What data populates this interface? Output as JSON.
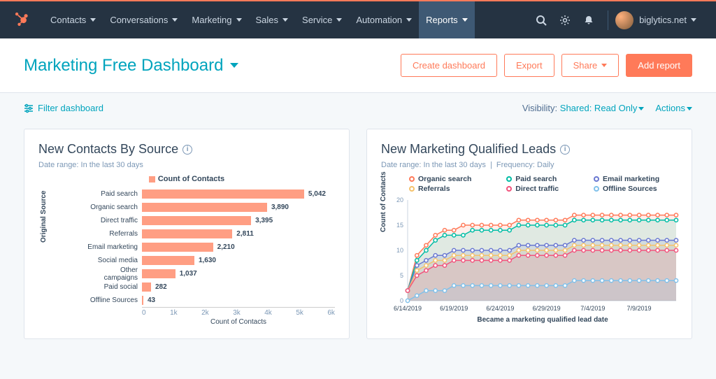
{
  "nav": {
    "items": [
      "Contacts",
      "Conversations",
      "Marketing",
      "Sales",
      "Service",
      "Automation",
      "Reports"
    ],
    "active_index": 6,
    "account": "biglytics.net"
  },
  "header": {
    "title": "Marketing Free Dashboard",
    "create": "Create dashboard",
    "export": "Export",
    "share": "Share",
    "add": "Add report"
  },
  "subheader": {
    "filter": "Filter dashboard",
    "vis_label": "Visibility:",
    "vis_value": "Shared: Read Only",
    "actions": "Actions"
  },
  "card1": {
    "title": "New Contacts By Source",
    "range_label": "Date range:",
    "range_value": "In the last 30 days",
    "legend": "Count of Contacts",
    "ylabel": "Original Source",
    "xlabel": "Count of Contacts"
  },
  "card2": {
    "title": "New Marketing Qualified Leads",
    "range_label": "Date range:",
    "range_value": "In the last 30 days",
    "freq_label": "Frequency:",
    "freq_value": "Daily",
    "ylabel": "Count of Contacts",
    "xlabel": "Became a marketing qualified lead date"
  },
  "chart_data": [
    {
      "type": "bar",
      "orientation": "horizontal",
      "categories": [
        "Paid search",
        "Organic search",
        "Direct traffic",
        "Referrals",
        "Email marketing",
        "Social media",
        "Other campaigns",
        "Paid social",
        "Offline Sources"
      ],
      "values": [
        5042,
        3890,
        3395,
        2811,
        2210,
        1630,
        1037,
        282,
        43
      ],
      "xlabel": "Count of Contacts",
      "ylabel": "Original Source",
      "xlim": [
        0,
        6000
      ],
      "xticks": [
        0,
        1000,
        2000,
        3000,
        4000,
        5000,
        6000
      ],
      "xtick_labels": [
        "0",
        "1k",
        "2k",
        "3k",
        "4k",
        "5k",
        "6k"
      ],
      "color": "#ff9e83"
    },
    {
      "type": "line",
      "x_labels": [
        "6/14/2019",
        "6/19/2019",
        "6/24/2019",
        "6/29/2019",
        "7/4/2019",
        "7/9/2019"
      ],
      "x": [
        0,
        1,
        2,
        3,
        4,
        5,
        6,
        7,
        8,
        9,
        10,
        11,
        12,
        13,
        14,
        15,
        16,
        17,
        18,
        19,
        20,
        21,
        22,
        23,
        24,
        25,
        26,
        27,
        28,
        29
      ],
      "series": [
        {
          "name": "Organic search",
          "color": "#ff7a59",
          "values": [
            2,
            9,
            11,
            13,
            14,
            14,
            15,
            15,
            15,
            15,
            15,
            15,
            16,
            16,
            16,
            16,
            16,
            16,
            17,
            17,
            17,
            17,
            17,
            17,
            17,
            17,
            17,
            17,
            17,
            17
          ]
        },
        {
          "name": "Paid search",
          "color": "#00bda5",
          "values": [
            2,
            8,
            10,
            12,
            13,
            13,
            13,
            14,
            14,
            14,
            14,
            14,
            15,
            15,
            15,
            15,
            15,
            15,
            16,
            16,
            16,
            16,
            16,
            16,
            16,
            16,
            16,
            16,
            16,
            16
          ]
        },
        {
          "name": "Email marketing",
          "color": "#6a78d1",
          "values": [
            2,
            7,
            8,
            9,
            9,
            10,
            10,
            10,
            10,
            10,
            10,
            10,
            11,
            11,
            11,
            11,
            11,
            11,
            12,
            12,
            12,
            12,
            12,
            12,
            12,
            12,
            12,
            12,
            12,
            12
          ]
        },
        {
          "name": "Referrals",
          "color": "#f5c26b",
          "values": [
            2,
            6,
            7,
            8,
            8,
            9,
            9,
            9,
            9,
            9,
            9,
            9,
            10,
            10,
            10,
            10,
            10,
            10,
            11,
            11,
            11,
            11,
            11,
            11,
            11,
            11,
            11,
            11,
            11,
            11
          ]
        },
        {
          "name": "Direct traffic",
          "color": "#f2547d",
          "values": [
            2,
            5,
            6,
            7,
            7,
            8,
            8,
            8,
            8,
            8,
            8,
            8,
            9,
            9,
            9,
            9,
            9,
            9,
            10,
            10,
            10,
            10,
            10,
            10,
            10,
            10,
            10,
            10,
            10,
            10
          ]
        },
        {
          "name": "Offline Sources",
          "color": "#81c1ea",
          "values": [
            0,
            1,
            2,
            2,
            2,
            3,
            3,
            3,
            3,
            3,
            3,
            3,
            3,
            3,
            3,
            3,
            3,
            3,
            4,
            4,
            4,
            4,
            4,
            4,
            4,
            4,
            4,
            4,
            4,
            4
          ]
        }
      ],
      "ylim": [
        0,
        20
      ],
      "yticks": [
        0,
        5,
        10,
        15,
        20
      ]
    }
  ]
}
